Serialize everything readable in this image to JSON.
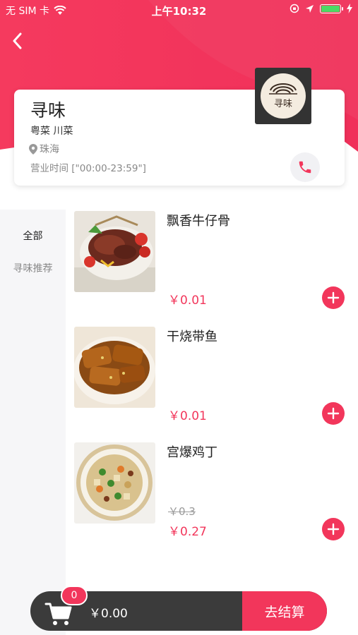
{
  "status_bar": {
    "carrier": "无 SIM 卡",
    "time": "上午10:32"
  },
  "shop": {
    "name": "寻味",
    "cuisine": "粤菜 川菜",
    "location": "珠海",
    "hours": "营业时间 [\"00:00-23:59\"]",
    "logo_text": "寻味"
  },
  "categories": [
    {
      "label": "全部",
      "active": true
    },
    {
      "label": "寻味推荐",
      "active": false
    }
  ],
  "dishes": [
    {
      "name": "飘香牛仔骨",
      "price": "￥0.01",
      "old_price": ""
    },
    {
      "name": "干烧带鱼",
      "price": "￥0.01",
      "old_price": ""
    },
    {
      "name": "宫爆鸡丁",
      "price": "￥0.27",
      "old_price": "￥0.3"
    }
  ],
  "cart": {
    "count": "0",
    "total": "￥0.00",
    "checkout_label": "去结算"
  },
  "colors": {
    "accent": "#f2365b",
    "cart_bg": "#3b3b3b"
  }
}
